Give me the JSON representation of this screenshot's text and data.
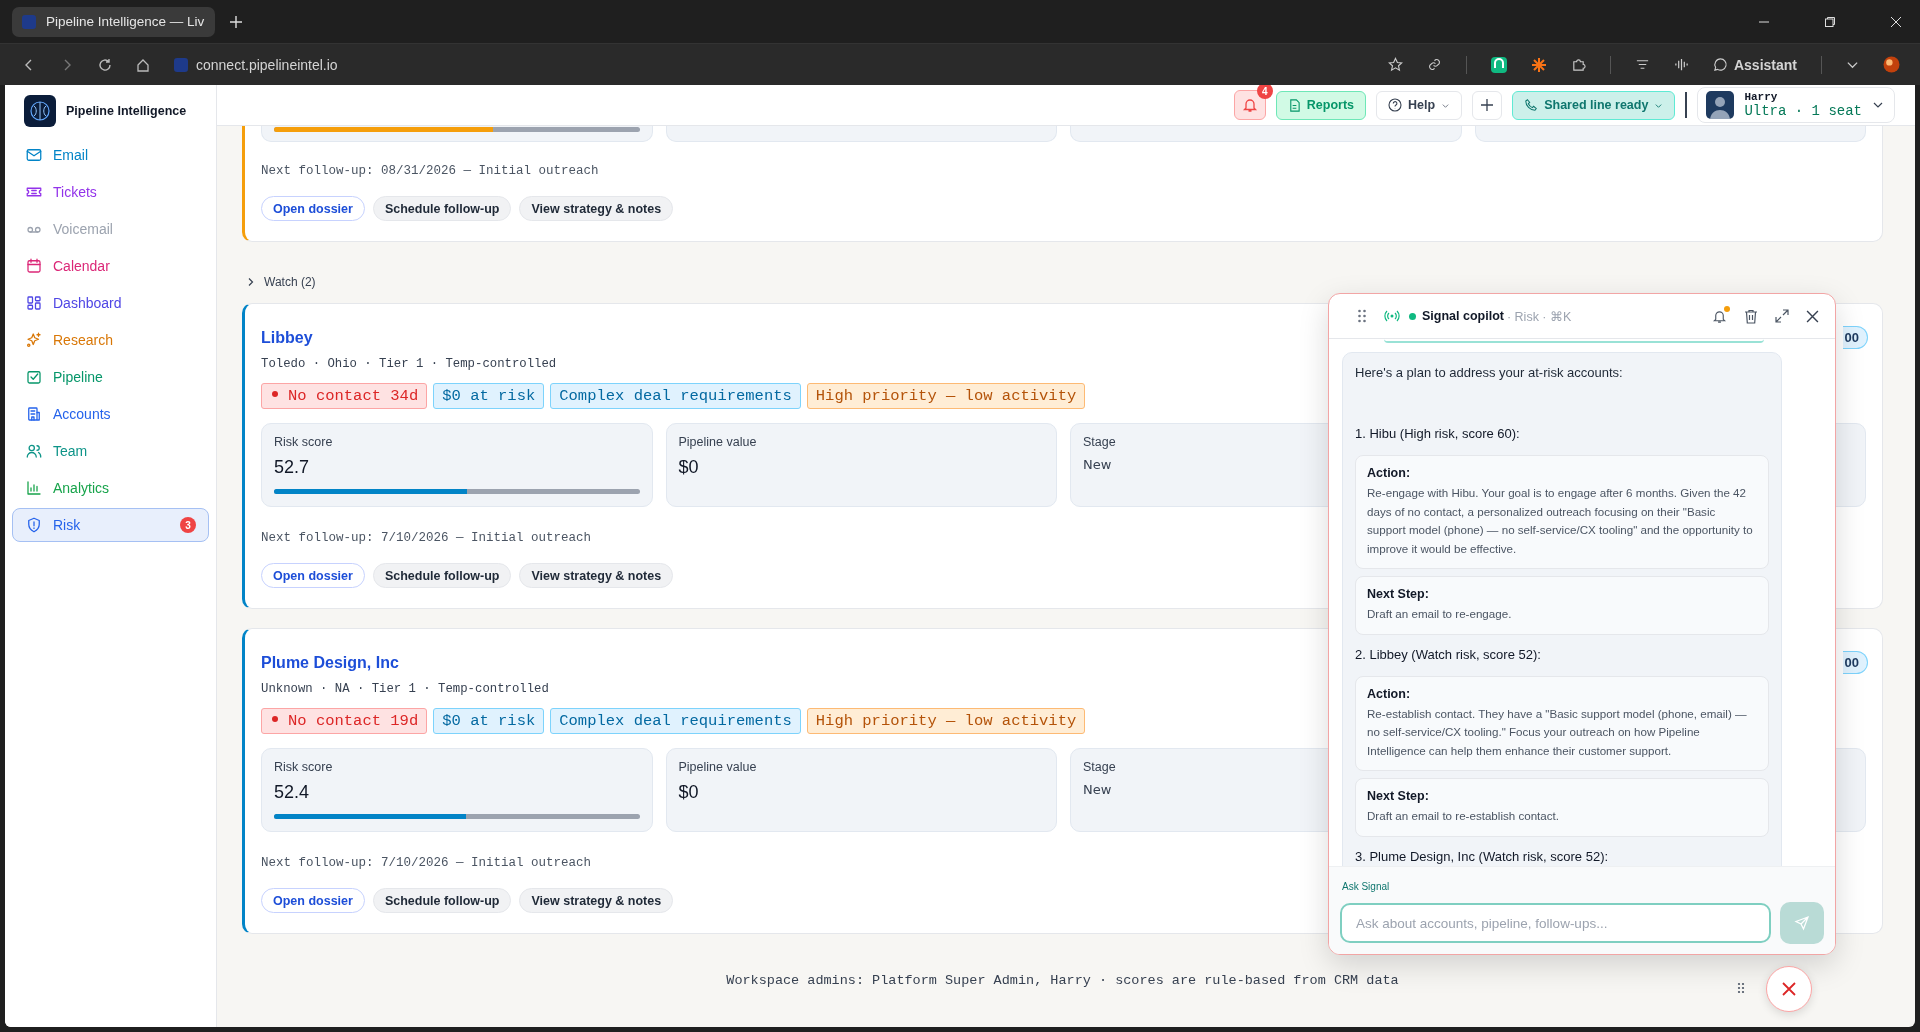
{
  "browser": {
    "tab_title": "Pipeline Intelligence — Liv",
    "address": "connect.pipelineintel.io",
    "assistant_label": "Assistant"
  },
  "sidebar": {
    "app_name": "Pipeline Intelligence",
    "items": [
      {
        "label": "Email",
        "color": "#0284c7",
        "selected": false
      },
      {
        "label": "Tickets",
        "color": "#9333ea",
        "selected": false
      },
      {
        "label": "Voicemail",
        "color": "#9ca3af",
        "selected": false
      },
      {
        "label": "Calendar",
        "color": "#db2777",
        "selected": false
      },
      {
        "label": "Dashboard",
        "color": "#4f46e5",
        "selected": false
      },
      {
        "label": "Research",
        "color": "#d97706",
        "selected": false
      },
      {
        "label": "Pipeline",
        "color": "#059669",
        "selected": false
      },
      {
        "label": "Accounts",
        "color": "#2563eb",
        "selected": false
      },
      {
        "label": "Team",
        "color": "#0d9488",
        "selected": false
      },
      {
        "label": "Analytics",
        "color": "#16a34a",
        "selected": false
      },
      {
        "label": "Risk",
        "color": "#2563eb",
        "selected": true,
        "badge": "3"
      }
    ]
  },
  "header": {
    "notification_count": "4",
    "reports": "Reports",
    "help": "Help",
    "line_status": "Shared line ready",
    "user": {
      "name": "Harry",
      "plan": "Ultra · 1 seat"
    }
  },
  "top_card": {
    "color": "#f59e0b",
    "level": 0.6,
    "next_follow_up": "Next follow-up: 08/31/2026 — Initial outreach",
    "actions": [
      "Open dossier",
      "Schedule follow-up",
      "View strategy & notes"
    ]
  },
  "group": {
    "label": "Watch (2)"
  },
  "accounts": [
    {
      "name": "Libbey",
      "meta": "Toledo · Ohio · Tier 1 · Temp-controlled",
      "color": "#0284c7",
      "corner_badge": "00",
      "tags": [
        {
          "kind": "alert",
          "label": "No contact 34d"
        },
        {
          "kind": "info",
          "label": "$0 at risk"
        },
        {
          "kind": "info",
          "label": "Complex deal requirements"
        },
        {
          "kind": "warning",
          "label": "High priority — low activity"
        }
      ],
      "stats": {
        "risk_label": "Risk score",
        "risk_value": "52.7",
        "level": 0.527,
        "pipeline_label": "Pipeline value",
        "pipeline_value": "$0",
        "stage_label": "Stage",
        "stage_value": "New"
      },
      "next_follow_up": "Next follow-up: 7/10/2026 — Initial outreach",
      "actions": [
        "Open dossier",
        "Schedule follow-up",
        "View strategy & notes"
      ]
    },
    {
      "name": "Plume Design, Inc",
      "meta": "Unknown · NA · Tier 1 · Temp-controlled",
      "color": "#0284c7",
      "corner_badge": "00",
      "tags": [
        {
          "kind": "alert",
          "label": "No contact 19d"
        },
        {
          "kind": "info",
          "label": "$0 at risk"
        },
        {
          "kind": "info",
          "label": "Complex deal requirements"
        },
        {
          "kind": "warning",
          "label": "High priority — low activity"
        }
      ],
      "stats": {
        "risk_label": "Risk score",
        "risk_value": "52.4",
        "level": 0.524,
        "pipeline_label": "Pipeline value",
        "pipeline_value": "$0",
        "stage_label": "Stage",
        "stage_value": "New"
      },
      "next_follow_up": "Next follow-up: 7/10/2026 — Initial outreach",
      "actions": [
        "Open dossier",
        "Schedule follow-up",
        "View strategy & notes"
      ]
    }
  ],
  "copilot": {
    "title": "Signal copilot",
    "subtitle": "· Risk · ⌘K",
    "online": true,
    "alert": true,
    "intro": "Here's a plan to address your at-risk accounts:",
    "sections": [
      {
        "heading": "1. Hibu (High risk, score 60):",
        "blocks": [
          {
            "title": "Action:",
            "text": "Re-engage with Hibu. Your goal is to engage after 6 months. Given the 42 days of no contact, a personalized outreach focusing on their \"Basic support model (phone) — no self-service/CX tooling\" and the opportunity to improve it would be effective."
          },
          {
            "title": "Next Step:",
            "text": "Draft an email to re-engage."
          }
        ]
      },
      {
        "heading": "2. Libbey (Watch risk, score 52):",
        "blocks": [
          {
            "title": "Action:",
            "text": "Re-establish contact. They have a \"Basic support model (phone, email) — no self-service/CX tooling.\" Focus your outreach on how Pipeline Intelligence can help them enhance their customer support."
          },
          {
            "title": "Next Step:",
            "text": "Draft an email to re-establish contact."
          }
        ]
      },
      {
        "heading": "3. Plume Design, Inc (Watch risk, score 52):"
      }
    ],
    "ask_label": "Ask Signal",
    "input": {
      "placeholder": "Ask about accounts, pipeline, follow-ups..."
    },
    "send_disabled": true
  },
  "footer": "Workspace admins: Platform Super Admin, Harry · scores are rule-based from CRM data"
}
